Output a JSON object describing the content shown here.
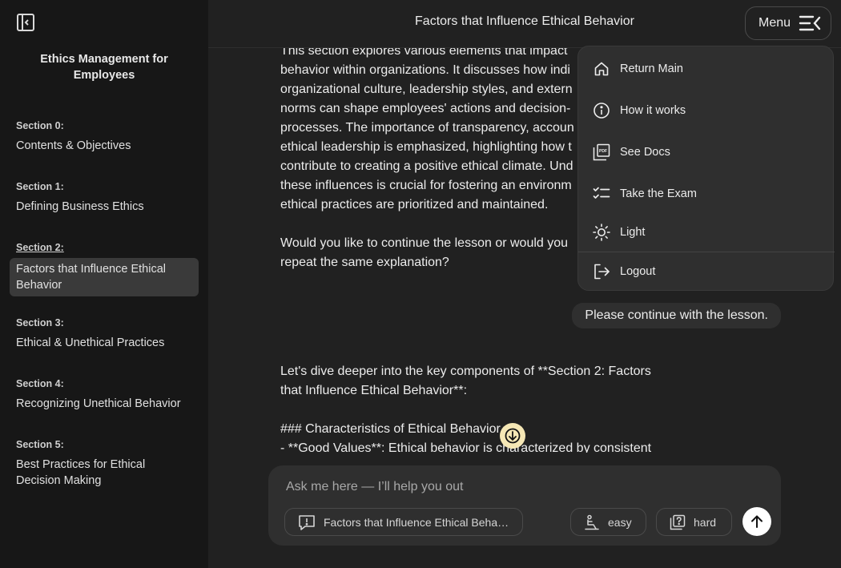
{
  "sidebar": {
    "course_title": "Ethics Management for Employees",
    "sections": [
      {
        "num": "Section 0:",
        "title": "Contents & Objectives"
      },
      {
        "num": "Section 1:",
        "title": "Defining Business Ethics"
      },
      {
        "num": "Section 2:",
        "title": "Factors that Influence Ethical Behavior"
      },
      {
        "num": "Section 3:",
        "title": "Ethical & Unethical Practices"
      },
      {
        "num": "Section 4:",
        "title": "Recognizing Unethical Behavior"
      },
      {
        "num": "Section 5:",
        "title": "Best Practices for Ethical Decision Making"
      }
    ]
  },
  "header": {
    "title": "Factors that Influence Ethical Behavior",
    "menu_label": "Menu"
  },
  "chat": {
    "assistant_message_1": "This section explores various elements that impact \nbehavior within organizations. It discusses how indi\norganizational culture, leadership styles, and extern\nnorms can shape employees' actions and decision-\nprocesses. The importance of transparency, accoun\nethical leadership is emphasized, highlighting how t\ncontribute to creating a positive ethical climate. Und\nthese influences is crucial for fostering an environm\nethical practices are prioritized and maintained.\n\nWould you like to continue the lesson or would you \nrepeat the same explanation?",
    "user_message": "Please continue with the lesson.",
    "assistant_message_2": "Let's dive deeper into the key components of **Section 2: Factors\nthat Influence Ethical Behavior**:\n\n### Characteristics of Ethical Behavior\n- **Good Values**: Ethical behavior is characterized by consistent"
  },
  "composer": {
    "placeholder": "Ask me here — I’ll help you out",
    "context_chip": "Factors that Influence Ethical Behavior",
    "easy_label": "easy",
    "hard_label": "hard"
  },
  "menu": {
    "items": [
      {
        "label": "Return Main",
        "icon": "home-icon"
      },
      {
        "label": "How it works",
        "icon": "info-icon"
      },
      {
        "label": "See Docs",
        "icon": "pdf-icon"
      },
      {
        "label": "Take the Exam",
        "icon": "checklist-icon"
      },
      {
        "label": "Light",
        "icon": "sun-icon"
      },
      {
        "label": "Logout",
        "icon": "logout-icon"
      }
    ]
  },
  "colors": {
    "background": "#212121",
    "sidebar": "#171717",
    "panel": "#2f2f2f",
    "scroll_button": "#f5e7b5"
  }
}
